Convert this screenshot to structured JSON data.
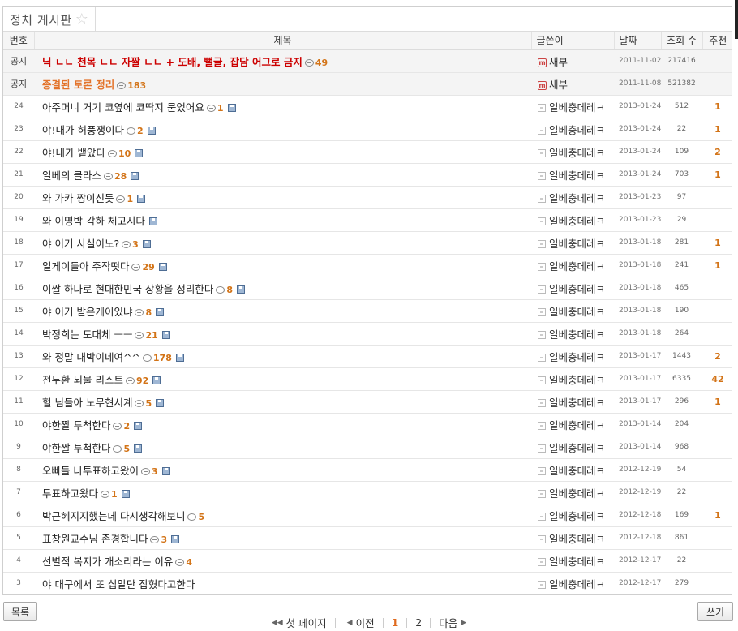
{
  "board": {
    "title": "정치 게시판"
  },
  "columns": {
    "no": "번호",
    "title": "제목",
    "author": "글쓴이",
    "date": "날짜",
    "views": "조회 수",
    "rec": "추천"
  },
  "notices": [
    {
      "no": "공지",
      "title": "닉 ㄴㄴ 천목 ㄴㄴ 자짤 ㄴㄴ + 도배, 뻘글, 잡담 어그로 금지",
      "comments": "49",
      "author": "새부",
      "date": "2011-11-02",
      "views": "217416",
      "rec": "",
      "style": "red"
    },
    {
      "no": "공지",
      "title": "종결된 토론 정리",
      "comments": "183",
      "author": "새부",
      "date": "2011-11-08",
      "views": "521382",
      "rec": "",
      "style": "orange"
    }
  ],
  "posts": [
    {
      "no": "24",
      "title": "아주머니 거기 코옆에 코딱지 묻었어요",
      "comments": "1",
      "author": "일베충데레ㅋ",
      "date": "2013-01-24",
      "views": "512",
      "rec": "1",
      "save": true
    },
    {
      "no": "23",
      "title": "야!내가 허풍쟁이다",
      "comments": "2",
      "author": "일베충데레ㅋ",
      "date": "2013-01-24",
      "views": "22",
      "rec": "1",
      "save": true
    },
    {
      "no": "22",
      "title": "야!내가 뱉았다",
      "comments": "10",
      "author": "일베충데레ㅋ",
      "date": "2013-01-24",
      "views": "109",
      "rec": "2",
      "save": true
    },
    {
      "no": "21",
      "title": "일베의 클라스",
      "comments": "28",
      "author": "일베충데레ㅋ",
      "date": "2013-01-24",
      "views": "703",
      "rec": "1",
      "save": true
    },
    {
      "no": "20",
      "title": "와 가카 짱이신듯",
      "comments": "1",
      "author": "일베충데레ㅋ",
      "date": "2013-01-23",
      "views": "97",
      "rec": "",
      "save": true
    },
    {
      "no": "19",
      "title": "와 이명박 각하 체고시다",
      "comments": "",
      "author": "일베충데레ㅋ",
      "date": "2013-01-23",
      "views": "29",
      "rec": "",
      "save": true
    },
    {
      "no": "18",
      "title": "야 이거 사실이노?",
      "comments": "3",
      "author": "일베충데레ㅋ",
      "date": "2013-01-18",
      "views": "281",
      "rec": "1",
      "save": true
    },
    {
      "no": "17",
      "title": "일게이들아 주작떳다",
      "comments": "29",
      "author": "일베충데레ㅋ",
      "date": "2013-01-18",
      "views": "241",
      "rec": "1",
      "save": true
    },
    {
      "no": "16",
      "title": "이짤 하나로 현대한민국 상황을 정리한다",
      "comments": "8",
      "author": "일베충데레ㅋ",
      "date": "2013-01-18",
      "views": "465",
      "rec": "",
      "save": true
    },
    {
      "no": "15",
      "title": "야 이거 받은게이있냐",
      "comments": "8",
      "author": "일베충데레ㅋ",
      "date": "2013-01-18",
      "views": "190",
      "rec": "",
      "save": true
    },
    {
      "no": "14",
      "title": "박정희는 도대체 ㅡㅡ",
      "comments": "21",
      "author": "일베충데레ㅋ",
      "date": "2013-01-18",
      "views": "264",
      "rec": "",
      "save": true
    },
    {
      "no": "13",
      "title": "와 정말 대박이네여^^",
      "comments": "178",
      "author": "일베충데레ㅋ",
      "date": "2013-01-17",
      "views": "1443",
      "rec": "2",
      "save": true
    },
    {
      "no": "12",
      "title": "전두환 뇌물 리스트",
      "comments": "92",
      "author": "일베충데레ㅋ",
      "date": "2013-01-17",
      "views": "6335",
      "rec": "42",
      "save": true
    },
    {
      "no": "11",
      "title": "헐 님들아 노무현시계",
      "comments": "5",
      "author": "일베충데레ㅋ",
      "date": "2013-01-17",
      "views": "296",
      "rec": "1",
      "save": true
    },
    {
      "no": "10",
      "title": "야한짤 투척한다",
      "comments": "2",
      "author": "일베충데레ㅋ",
      "date": "2013-01-14",
      "views": "204",
      "rec": "",
      "save": true
    },
    {
      "no": "9",
      "title": "야한짤 투척한다",
      "comments": "5",
      "author": "일베충데레ㅋ",
      "date": "2013-01-14",
      "views": "968",
      "rec": "",
      "save": true
    },
    {
      "no": "8",
      "title": "오빠들 나투표하고왔어",
      "comments": "3",
      "author": "일베충데레ㅋ",
      "date": "2012-12-19",
      "views": "54",
      "rec": "",
      "save": true
    },
    {
      "no": "7",
      "title": "투표하고왔다",
      "comments": "1",
      "author": "일베충데레ㅋ",
      "date": "2012-12-19",
      "views": "22",
      "rec": "",
      "save": true
    },
    {
      "no": "6",
      "title": "박근혜지지했는데 다시생각해보니",
      "comments": "5",
      "author": "일베충데레ㅋ",
      "date": "2012-12-18",
      "views": "169",
      "rec": "1",
      "save": false
    },
    {
      "no": "5",
      "title": "표창원교수님 존경합니다",
      "comments": "3",
      "author": "일베충데레ㅋ",
      "date": "2012-12-18",
      "views": "861",
      "rec": "",
      "save": true
    },
    {
      "no": "4",
      "title": "선별적 복지가 개소리라는 이유",
      "comments": "4",
      "author": "일베충데레ㅋ",
      "date": "2012-12-17",
      "views": "22",
      "rec": "",
      "save": false
    },
    {
      "no": "3",
      "title": "야 대구에서 또 십알단 잡혔다고한다",
      "comments": "",
      "author": "일베충데레ㅋ",
      "date": "2012-12-17",
      "views": "279",
      "rec": "",
      "save": false
    }
  ],
  "buttons": {
    "list": "목록",
    "write": "쓰기"
  },
  "pager": {
    "first": "첫 페이지",
    "prev": "이전",
    "pages": [
      "1",
      "2"
    ],
    "current": "1",
    "next": "다음"
  },
  "colors": {
    "accent": "#d37418",
    "notice_red": "#cc0000",
    "notice_orange": "#e3732a"
  },
  "icons": {
    "star": "star-icon",
    "comment": "comment-bubble-icon",
    "save": "floppy-disk-icon",
    "member": "member-icon",
    "user": "user-icon"
  }
}
